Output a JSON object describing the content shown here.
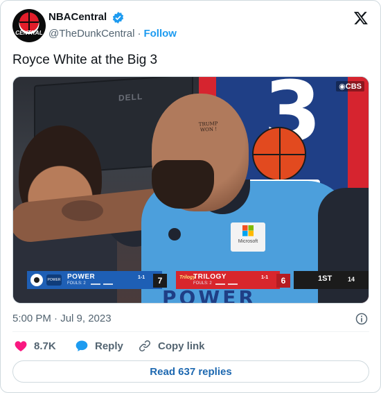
{
  "author": {
    "display_name": "NBACentral",
    "handle": "@TheDunkCentral",
    "separator": "·",
    "follow_label": "Follow",
    "verified": true,
    "avatar_text": "CENTRAL"
  },
  "tweet": {
    "text": "Royce White at the Big 3"
  },
  "media": {
    "broadcaster": "◉CBS",
    "monitor_label": "DELL",
    "head_tattoo_line1": "TRUMP",
    "head_tattoo_line2": "WON !",
    "sponsor": "Microsoft",
    "jersey_text": "POWER",
    "scoreboard": {
      "home_team": "POWER",
      "home_logo_text": "POWER",
      "home_fouls": "FOULS: 2",
      "home_record": "1-1",
      "home_score": "7",
      "away_logo_text": "Trilogy",
      "away_team": "TRILOGY",
      "away_fouls": "FOULS: 2",
      "away_record": "1-1",
      "away_score": "6",
      "quarter": "1ST",
      "clock": "14"
    }
  },
  "meta": {
    "timestamp": "5:00 PM · Jul 9, 2023"
  },
  "actions": {
    "likes_count": "8.7K",
    "reply_label": "Reply",
    "copy_link_label": "Copy link"
  },
  "read_replies_label": "Read 637 replies",
  "colors": {
    "accent": "#1d9bf0",
    "like": "#f91880",
    "reply_icon": "#1d9bf0",
    "text_secondary": "#536471",
    "border": "#cfd9de"
  },
  "icons": {
    "verified": "verified-badge-icon",
    "x_logo": "x-logo-icon",
    "info": "info-icon",
    "like": "heart-icon",
    "reply": "speech-bubble-icon",
    "copy_link": "link-icon"
  }
}
